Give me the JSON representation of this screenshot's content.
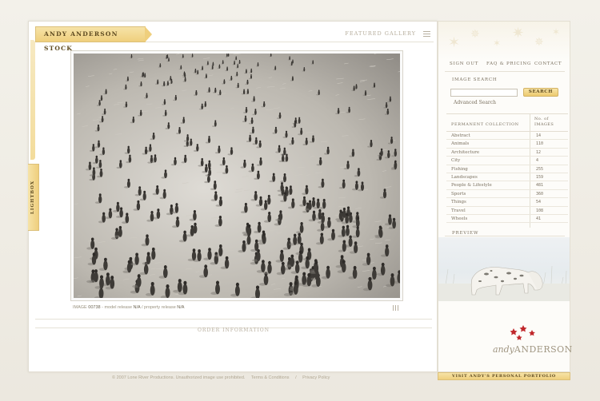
{
  "header": {
    "brand": "ANDY ANDERSON STOCK",
    "featured": "FEATURED GALLERY"
  },
  "lightbox": {
    "label": "LIGHTBOX"
  },
  "caption": {
    "prefix": "IMAGE",
    "image_id": "00738",
    "model_text": "- model release",
    "model_value": "N/A",
    "property_text": "/ property release",
    "property_value": "N/A"
  },
  "order": {
    "label": "ORDER INFORMATION"
  },
  "footer": {
    "copyright": "© 2007 Lone River Productions. Unauthorized image use prohibited.",
    "terms": "Terms & Conditions",
    "privacy": "Privacy Policy"
  },
  "nav": {
    "signout": "SIGN OUT",
    "faq": "FAQ & PRICING",
    "contact": "CONTACT"
  },
  "search": {
    "label": "IMAGE SEARCH",
    "value": "",
    "button": "SEARCH",
    "advanced": "Advanced Search"
  },
  "collection": {
    "header_name": "PERMANENT COLLECTION",
    "header_count_line1": "No. of",
    "header_count_line2": "IMAGES",
    "rows": [
      {
        "name": "Abstract",
        "count": "14"
      },
      {
        "name": "Animals",
        "count": "110"
      },
      {
        "name": "Architecture",
        "count": "12"
      },
      {
        "name": "City",
        "count": "4"
      },
      {
        "name": "Fishing",
        "count": "255"
      },
      {
        "name": "Landscapes",
        "count": "159"
      },
      {
        "name": "People & Lifestyle",
        "count": "481"
      },
      {
        "name": "Sports",
        "count": "360"
      },
      {
        "name": "Things",
        "count": "54"
      },
      {
        "name": "Travel",
        "count": "108"
      },
      {
        "name": "Wheels",
        "count": "41"
      }
    ]
  },
  "preview": {
    "label": "PREVIEW"
  },
  "logo": {
    "first": "andy",
    "last": "ANDERSON"
  },
  "visit": {
    "label": "VISIT ANDY'S PERSONAL PORTFOLIO"
  },
  "colors": {
    "gold": "#efcf7d",
    "logo_star": "#c0282c",
    "text": "#7a705f"
  }
}
